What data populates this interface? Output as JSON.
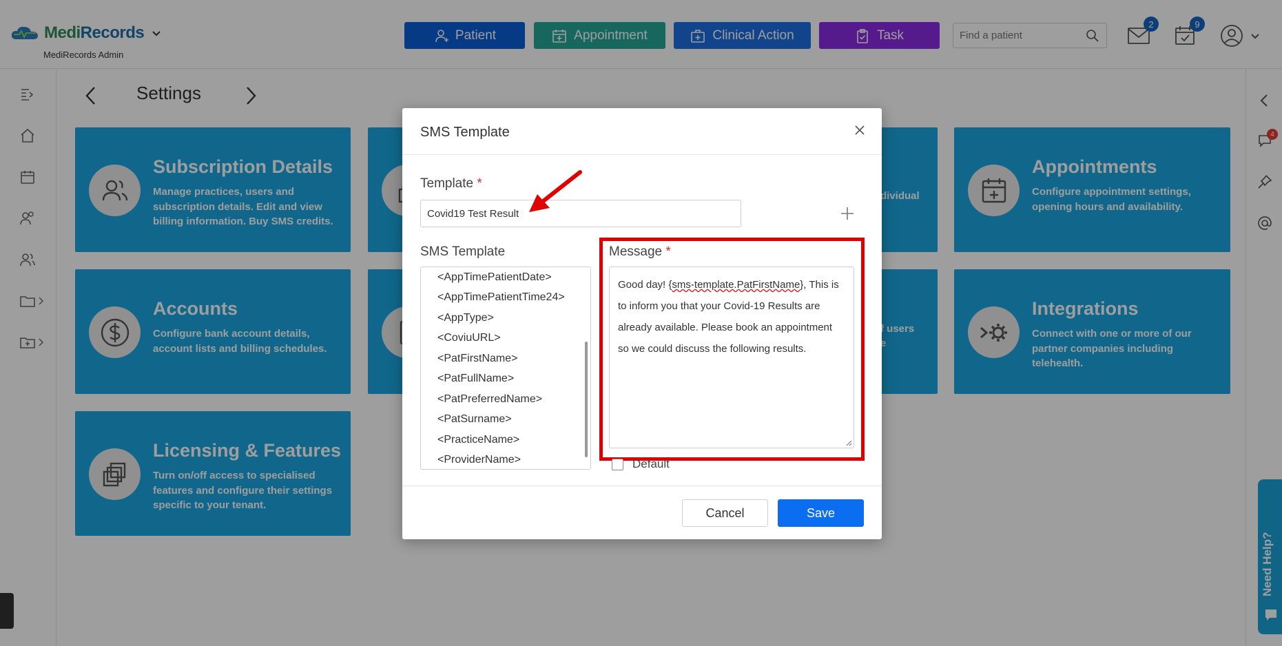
{
  "header": {
    "brand_part1": "Medi",
    "brand_part2": "Records",
    "admin_label": "MediRecords Admin",
    "nav": {
      "patient": "Patient",
      "appointment": "Appointment",
      "clinical_action": "Clinical Action",
      "task": "Task"
    },
    "search_placeholder": "Find a patient",
    "mail_badge": "2",
    "calendar_badge": "9"
  },
  "page": {
    "title": "Settings"
  },
  "cards": {
    "subscription": {
      "title": "Subscription Details",
      "desc": "Manage practices, users and subscription details. Edit and view billing information. Buy SMS credits."
    },
    "accounts": {
      "title": "Accounts",
      "desc": "Configure bank account details, account lists and billing schedules."
    },
    "licensing": {
      "title": "Licensing & Features",
      "desc": "Turn on/off access to specialised features and configure their settings specific to your tenant."
    },
    "appointments": {
      "title": "Appointments",
      "desc": "Configure appointment settings, opening hours and availability."
    },
    "integrations": {
      "title": "Integrations",
      "desc": "Connect with one or more of our partner companies including telehealth."
    },
    "fragment_individual": "dividual",
    "fragment_users": "f users",
    "fragment_e": "e"
  },
  "right_rail": {
    "chat_badge": "4",
    "need_help": "Need Help?"
  },
  "modal": {
    "title": "SMS Template",
    "template_label": "Template",
    "template_value": "Covid19 Test Result",
    "list_label": "SMS Template",
    "list_items": [
      "<AppTimePatientDate>",
      "<AppTimePatientTime24>",
      "<AppType>",
      "<CoviuURL>",
      "<PatFirstName>",
      "<PatFullName>",
      "<PatPreferredName>",
      "<PatSurname>",
      "<PracticeName>",
      "<ProviderName>"
    ],
    "message_label": "Message",
    "message_before": "Good day! {",
    "message_token": "sms-template.PatFirstName",
    "message_after": "}, This is to inform you that your Covid-19 Results are already available. Please book an appointment so we could discuss the following results.",
    "default_label": "Default",
    "cancel": "Cancel",
    "save": "Save"
  },
  "colors": {
    "card_bg": "#1ba7e0",
    "patient": "#0b5ed7",
    "appointment": "#26a69a",
    "clinical_action": "#1e6fe0",
    "task": "#8a2be2",
    "save": "#0b6df0",
    "highlight": "#e10000"
  }
}
